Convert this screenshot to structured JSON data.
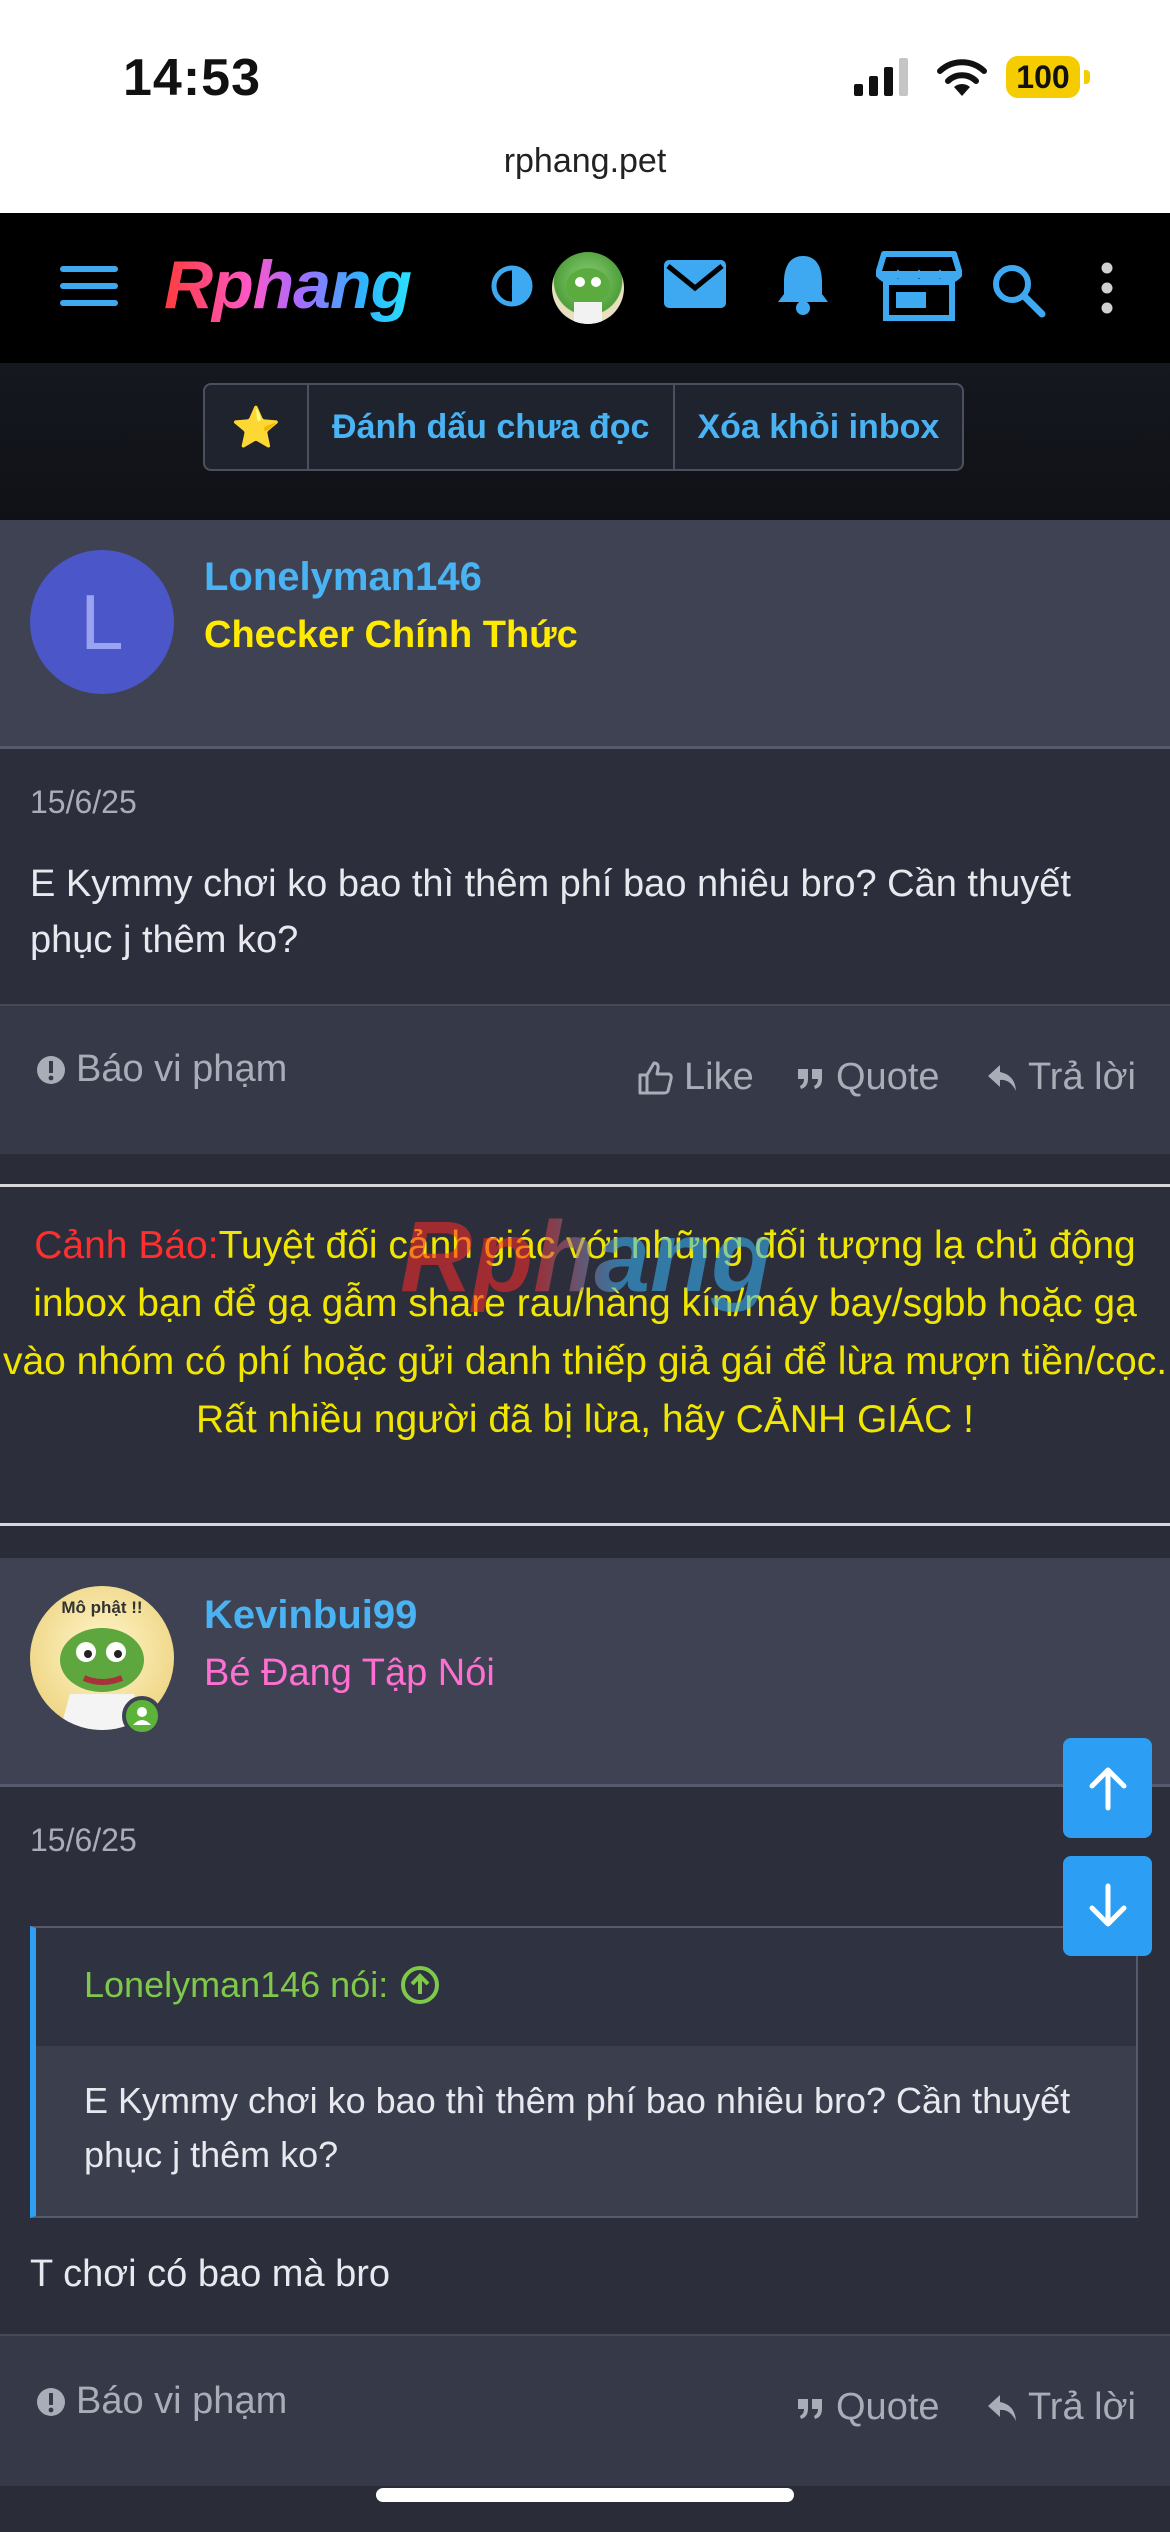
{
  "status_bar": {
    "time": "14:53",
    "battery": "100",
    "url": "rphang.pet"
  },
  "nav": {
    "logo": "Rphang",
    "icons": [
      "menu-icon",
      "theme-toggle-icon",
      "avatar",
      "mail-icon",
      "bell-icon",
      "store-icon",
      "search-icon",
      "more-icon"
    ]
  },
  "toolbar": {
    "star": "⭐",
    "mark_unread": "Đánh dấu chưa đọc",
    "remove_inbox": "Xóa khỏi inbox"
  },
  "posts": [
    {
      "avatar_letter": "L",
      "avatar_color": "#4b57c8",
      "username": "Lonelyman146",
      "user_title": "Checker Chính Thức",
      "user_title_color": "#ffea00",
      "date": "15/6/25",
      "message": "E Kymmy chơi ko bao thì thêm phí bao nhiêu bro? Cần thuyết phục j thêm ko?",
      "report": "Báo vi phạm",
      "like": "Like",
      "quote": "Quote",
      "reply": "Trả lời"
    },
    {
      "avatar_text": "Mô phật !!",
      "username": "Kevinbui99",
      "user_title": "Bé Đang Tập Nói",
      "user_title_color": "#ff6fd2",
      "date": "15/6/25",
      "quote_author": "Lonelyman146 nói:",
      "quote_text": "E Kymmy chơi ko bao thì thêm phí bao nhiêu bro? Cần thuyết phục j thêm ko?",
      "message": "T chơi có bao mà bro",
      "report": "Báo vi phạm",
      "quote": "Quote",
      "reply": "Trả lời"
    }
  ],
  "warning": {
    "label": "Cảnh Báo:",
    "text": "Tuyệt đối cảnh giác với những đối tượng lạ chủ động inbox bạn để gạ gẫm share rau/hàng kín/máy bay/sgbb hoặc gạ vào nhóm có phí hoặc gửi danh thiếp giả gái để lừa mượn tiền/cọc.",
    "line2": "Rất nhiều người đã bị lừa, hãy CẢNH GIÁC !",
    "watermark": "Rphang"
  }
}
